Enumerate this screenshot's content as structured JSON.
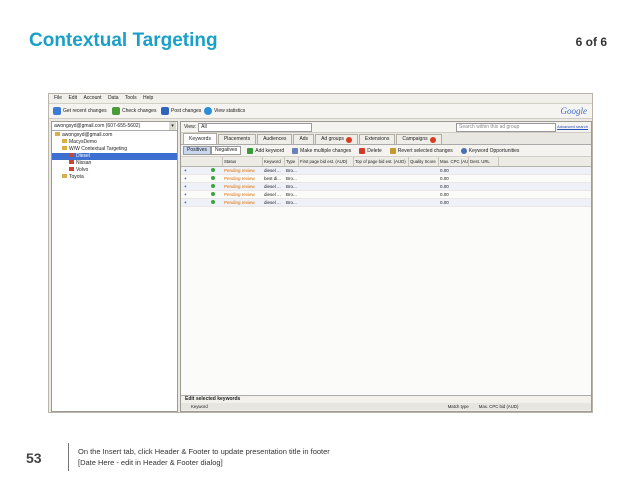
{
  "slide": {
    "title": "Contextual Targeting",
    "counter": "6 of 6",
    "number": "53",
    "footer_lines": [
      "On the Insert tab, click Header & Footer to update presentation title in footer",
      "[Date Here - edit in Header & Footer dialog]"
    ]
  },
  "app": {
    "menu": [
      "File",
      "Edit",
      "Account",
      "Data",
      "Tools",
      "Help"
    ],
    "toolbar": {
      "get_recent": "Get recent changes",
      "check": "Check changes",
      "post": "Post changes",
      "view_stats": "View statistics"
    },
    "logo": "Google",
    "account_select": "awongsyd@gmail.com (607-655-5602)",
    "tree": [
      {
        "label": "awongsyd@gmail.com",
        "indent": 0,
        "selected": false
      },
      {
        "label": "MacysDemo",
        "indent": 1,
        "selected": false
      },
      {
        "label": "W/W Contextual Targeting",
        "indent": 1,
        "selected": false
      },
      {
        "label": "Diesel",
        "indent": 2,
        "selected": true
      },
      {
        "label": "Nissan",
        "indent": 2,
        "selected": false
      },
      {
        "label": "Volvo",
        "indent": 2,
        "selected": false
      },
      {
        "label": "Toyota",
        "indent": 1,
        "selected": false
      }
    ],
    "view_label": "View:",
    "view_value": "All",
    "search_placeholder": "Search within this ad group",
    "advanced_search": "Advanced search",
    "tabs": [
      "Keywords",
      "Placements",
      "Audiences",
      "Ads",
      "Ad groups",
      "Extensions",
      "Campaigns"
    ],
    "tab_badges": [
      false,
      false,
      false,
      false,
      true,
      false,
      true
    ],
    "seg_positives": "Positives",
    "seg_negatives": "Negatives",
    "actions": {
      "add": "Add keyword",
      "multi": "Make multiple changes",
      "delete": "Delete",
      "revert": "Revert selected changes",
      "opps": "Keyword Opportunities"
    },
    "columns": [
      "Status",
      "Keyword",
      "Type",
      "First page bid est. (AUD)",
      "Top of page bid est. (AUD)",
      "Quality Score",
      "Max. CPC (AUD)",
      "Dest. URL"
    ],
    "rows": [
      {
        "status": "Pending review",
        "keyword": "diesel ...",
        "type": "Bro...",
        "cpc": "0.00"
      },
      {
        "status": "Pending review",
        "keyword": "best di...",
        "type": "Bro...",
        "cpc": "0.00"
      },
      {
        "status": "Pending review",
        "keyword": "diesel ...",
        "type": "Bro...",
        "cpc": "0.00"
      },
      {
        "status": "Pending review",
        "keyword": "diesel ...",
        "type": "Bro...",
        "cpc": "0.00"
      },
      {
        "status": "Pending review",
        "keyword": "diesel ...",
        "type": "Bro...",
        "cpc": "0.00"
      }
    ],
    "edit_panel": {
      "title": "Edit selected keywords",
      "col_keyword": "Keyword",
      "col_match": "Match type",
      "col_cpc": "Max. CPC bid (AUD)"
    }
  }
}
